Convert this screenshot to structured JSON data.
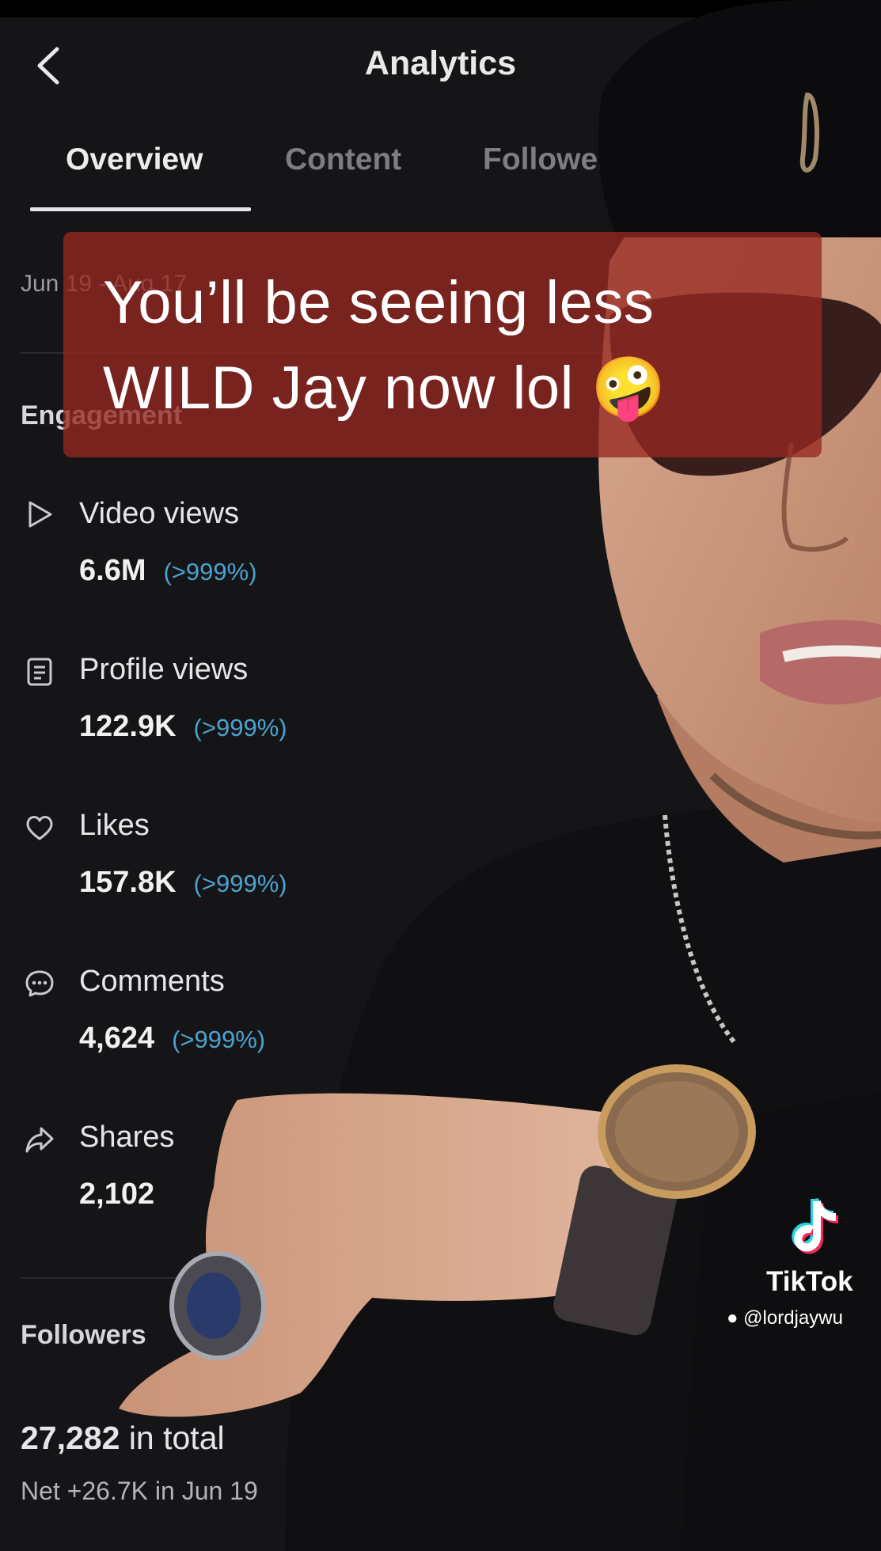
{
  "header": {
    "title": "Analytics"
  },
  "tabs": [
    {
      "label": "Overview",
      "active": true
    },
    {
      "label": "Content",
      "active": false
    },
    {
      "label": "Followers",
      "active": false
    }
  ],
  "date_range": "Jun 19 - Aug 17",
  "engagement": {
    "section_label": "Engagement",
    "metrics": [
      {
        "label": "Video views",
        "value": "6.6M",
        "change": "(>999%)",
        "icon": "play-icon"
      },
      {
        "label": "Profile views",
        "value": "122.9K",
        "change": "(>999%)",
        "icon": "profile-card-icon"
      },
      {
        "label": "Likes",
        "value": "157.8K",
        "change": "(>999%)",
        "icon": "heart-icon"
      },
      {
        "label": "Comments",
        "value": "4,624",
        "change": "(>999%)",
        "icon": "comment-icon"
      },
      {
        "label": "Shares",
        "value": "2,102",
        "change": "",
        "icon": "share-icon"
      }
    ]
  },
  "followers": {
    "section_label": "Followers",
    "total_value": "27,282",
    "total_suffix": "in total",
    "net": "Net +26.7K in Jun 19"
  },
  "caption": {
    "line1": "You’ll be seeing less",
    "line2": "WILD Jay now lol",
    "emoji": "🤪"
  },
  "watermark": {
    "brand": "TikTok",
    "handle": "@lordjaywu"
  },
  "colors": {
    "background": "#151518",
    "accent_change": "#4aa3ce",
    "caption_bg": "#962821"
  }
}
